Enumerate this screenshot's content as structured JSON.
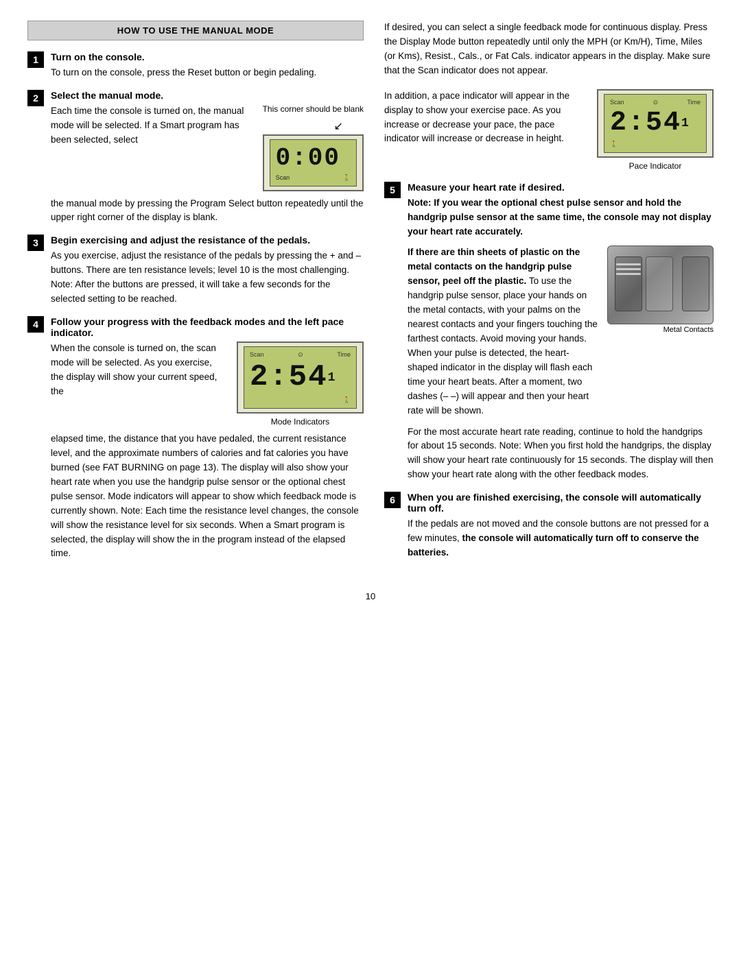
{
  "page": {
    "number": "10"
  },
  "header": {
    "title": "HOW TO USE THE MANUAL MODE"
  },
  "steps": {
    "step1": {
      "number": "1",
      "title": "Turn on the console.",
      "body": "To turn on the console, press the Reset button or begin pedaling."
    },
    "step2": {
      "number": "2",
      "title": "Select the manual mode.",
      "body_part1": "Each time the console is turned on, the manual mode will be selected. If a Smart program has been selected, select",
      "body_part2": "the manual mode by pressing the Program Select button repeatedly until the upper right corner of the display is blank.",
      "figure_note": "This corner should be blank",
      "figure_digits": "0:00",
      "scan_label": "Scan"
    },
    "step3": {
      "number": "3",
      "title": "Begin exercising and adjust the resistance of the pedals.",
      "body": "As you exercise, adjust the resistance of the pedals by pressing the + and – buttons. There are ten resistance levels; level 10 is the most challenging. Note: After the buttons are pressed, it will take a few seconds for the selected setting to be reached."
    },
    "step4": {
      "number": "4",
      "title": "Follow your progress with the feedback modes and the left pace indicator.",
      "body_part1": "When the console is turned on, the scan mode will be selected. As you exercise, the display will show your current speed, the",
      "body_part2": "elapsed time, the distance that you have pedaled, the current resistance level, and the approximate numbers of calories and fat calories you have burned (see FAT BURNING on page 13). The display will also show your heart rate when you use the handgrip pulse sensor or the optional chest pulse sensor. Mode indicators will appear to show which feedback mode is currently shown. Note: Each time the resistance level changes, the console will show the resistance level for six seconds. When a Smart program is selected, the display will show the",
      "body_part3": "in the program instead of the elapsed time.",
      "figure_digits": "2:54",
      "figure_small": "1",
      "scan_label": "Scan",
      "time_label": "Time",
      "figure_label": "Mode Indicators"
    },
    "step5": {
      "number": "5",
      "title": "Measure your heart rate if desired.",
      "note": "Note: If you wear the optional chest pulse sensor and hold the handgrip pulse sensor at the same time, the console may not display your heart rate accurately.",
      "heartrate_intro": "If there are thin sheets of plastic on the metal contacts on the handgrip pulse sensor, peel off the",
      "heartrate_bold": "plastic.",
      "heartrate_body": " To use the handgrip pulse sensor, place your hands on the metal contacts, with your palms on the nearest contacts and your fingers touching the farthest contacts. Avoid moving your hands. When your pulse is detected, the heart-shaped indicator in the display will flash each time your heart beats. After a moment, two dashes (– –) will appear and then your heart rate will be shown.",
      "metal_contacts_label": "Metal Contacts",
      "heartrate_p2": "For the most accurate heart rate reading, continue to hold the handgrips for about 15 seconds. Note: When you first hold the handgrips, the display will show your heart rate continuously for 15 seconds. The display will then show your heart rate along with the other feedback modes."
    },
    "step6": {
      "number": "6",
      "title": "When you are finished exercising, the console will automatically turn off.",
      "body_p1": "If the pedals are not moved and the console buttons are not pressed for a few minutes, ",
      "body_bold": "the console will automatically turn off to conserve the batteries.",
      "body_p1_prefix": "If the pedals are not moved and the console buttons are not pressed for a few minutes, "
    }
  },
  "right_col": {
    "intro": "If desired, you can select a single feedback mode for continuous display. Press the Display Mode button repeatedly until only the MPH (or Km/H), Time, Miles (or Kms), Resist., Cals., or Fat Cals. indicator appears in the display. Make sure that the Scan indicator does not appear.",
    "pace_text_p1": "In addition, a pace indicator will appear in the display to show your exercise pace. As you increase or decrease your pace, the pace indicator will increase or decrease in height.",
    "pace_indicator_label": "Pace Indicator",
    "pace_digits": "2:54",
    "pace_small": "1",
    "scan_label": "Scan",
    "time_label": "Time"
  }
}
